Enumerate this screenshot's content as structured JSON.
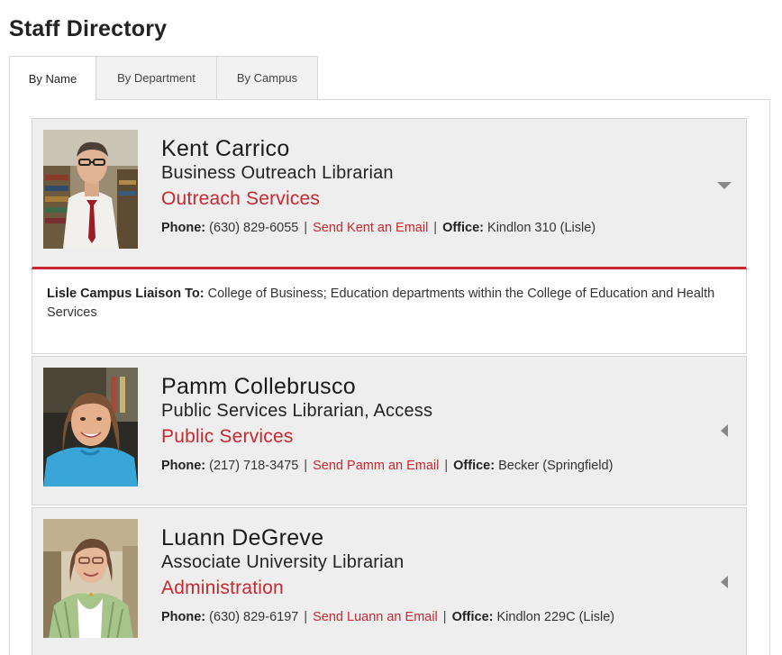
{
  "page": {
    "title": "Staff Directory"
  },
  "tabs": [
    {
      "label": "By Name",
      "active": true
    },
    {
      "label": "By Department",
      "active": false
    },
    {
      "label": "By Campus",
      "active": false
    }
  ],
  "labels": {
    "phone": "Phone:",
    "office": "Office:",
    "separator": "|"
  },
  "colors": {
    "accent": "#c8282f",
    "card_bg": "#eeeeee",
    "border": "#d4d4d4"
  },
  "staff": [
    {
      "name": "Kent Carrico",
      "title": "Business Outreach Librarian",
      "department": "Outreach Services",
      "phone": "(630) 829-6055",
      "email_label": "Send Kent an Email",
      "office": "Kindlon 310 (Lisle)",
      "expanded": true,
      "toggle_icon": "caret-down-icon",
      "liaison_label": "Lisle Campus Liaison To:",
      "liaison_text": "College of Business; Education departments within the College of Education and Health Services"
    },
    {
      "name": "Pamm Collebrusco",
      "title": "Public Services Librarian, Access",
      "department": "Public Services",
      "phone": "(217) 718-3475",
      "email_label": "Send Pamm an Email",
      "office": "Becker (Springfield)",
      "expanded": false,
      "toggle_icon": "caret-left-icon"
    },
    {
      "name": "Luann DeGreve",
      "title": "Associate University Librarian",
      "department": "Administration",
      "phone": "(630) 829-6197",
      "email_label": "Send Luann an Email",
      "office": "Kindlon 229C (Lisle)",
      "expanded": false,
      "toggle_icon": "caret-left-icon"
    }
  ]
}
